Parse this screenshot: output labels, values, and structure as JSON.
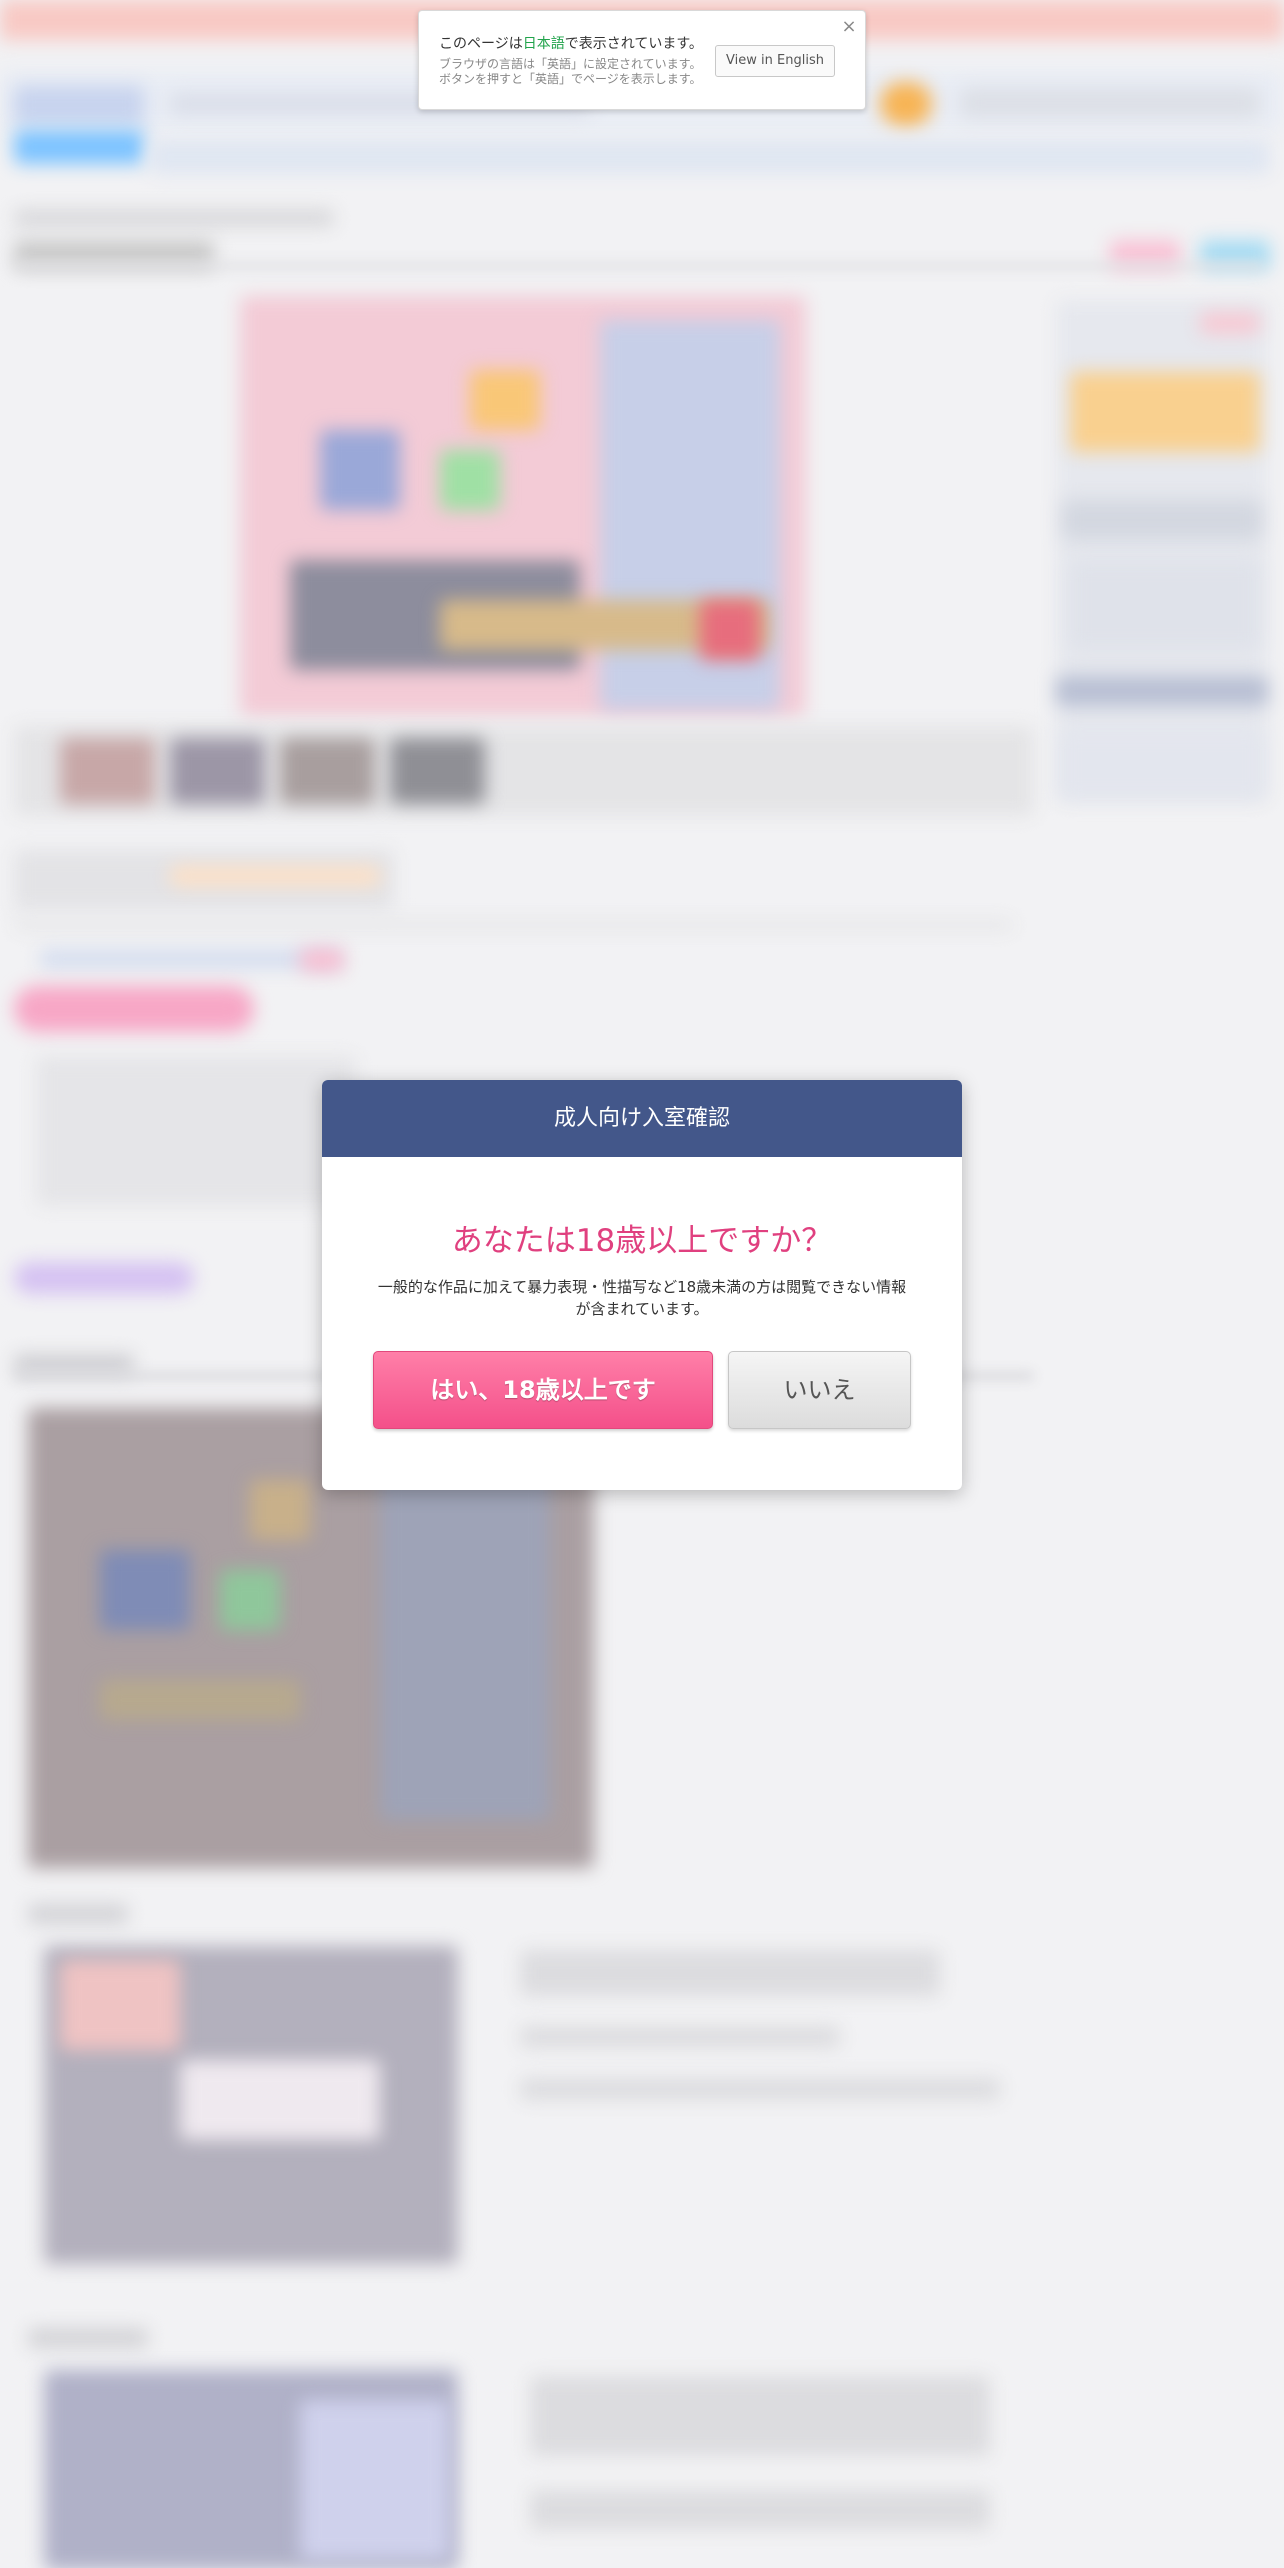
{
  "language_notice": {
    "prefix": "このページは",
    "language": "日本語",
    "suffix": "で表示されています。",
    "sub_line1": "ブラウザの言語は「英語」に設定されています。",
    "sub_line2": "ボタンを押すと「英語」でページを表示します。",
    "button_label": "View in English",
    "close_icon": "×",
    "highlight_color": "#21a34b"
  },
  "age_gate": {
    "title": "成人向け入室確認",
    "question": "あなたは18歳以上ですか？",
    "description": "一般的な作品に加えて暴力表現・性描写など18歳未満の方は閲覧できない情報が含まれています。",
    "yes_label": "はい、18歳以上です",
    "no_label": "いいえ",
    "header_color": "#43578a",
    "accent_color": "#e0407f"
  },
  "background": {
    "state": "blurred"
  }
}
